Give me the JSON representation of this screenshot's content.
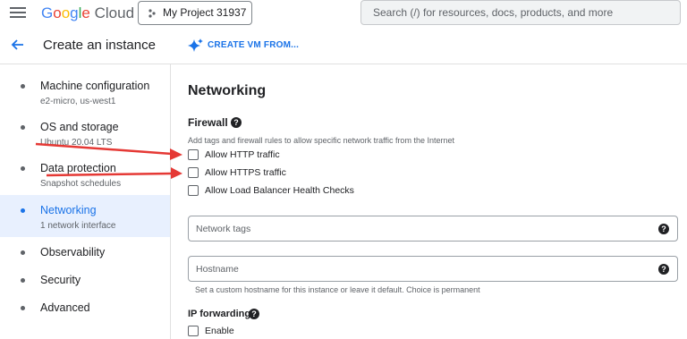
{
  "topbar": {
    "logo_google": [
      "G",
      "o",
      "o",
      "g",
      "l",
      "e"
    ],
    "logo_cloud": "Cloud",
    "project": "My Project 31937",
    "search_placeholder": "Search (/) for resources, docs, products, and more"
  },
  "header": {
    "title": "Create an instance",
    "create_vm": "CREATE VM FROM..."
  },
  "nav": [
    {
      "label": "Machine configuration",
      "sub": "e2-micro, us-west1"
    },
    {
      "label": "OS and storage",
      "sub": "Ubuntu 20.04 LTS"
    },
    {
      "label": "Data protection",
      "sub": "Snapshot schedules"
    },
    {
      "label": "Networking",
      "sub": "1 network interface"
    },
    {
      "label": "Observability"
    },
    {
      "label": "Security"
    },
    {
      "label": "Advanced"
    }
  ],
  "main": {
    "section_title": "Networking",
    "firewall": {
      "title": "Firewall",
      "description": "Add tags and firewall rules to allow specific network traffic from the Internet",
      "options": [
        "Allow HTTP traffic",
        "Allow HTTPS traffic",
        "Allow Load Balancer Health Checks"
      ]
    },
    "network_tags_placeholder": "Network tags",
    "hostname_placeholder": "Hostname",
    "hostname_hint": "Set a custom hostname for this instance or leave it default. Choice is permanent",
    "ip_forwarding": {
      "title": "IP forwarding",
      "option": "Enable"
    }
  },
  "colors": {
    "accent": "#1a73e8",
    "active_bg": "#e8f0fe",
    "arrow": "#e53935"
  }
}
